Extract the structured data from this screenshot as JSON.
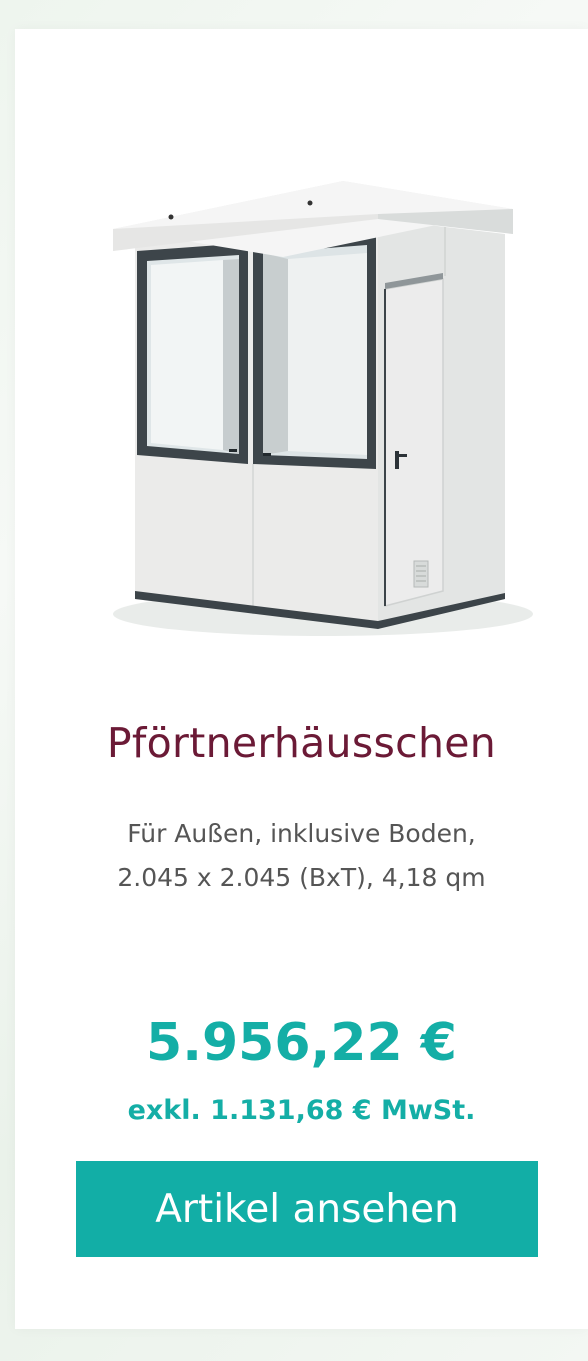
{
  "product": {
    "title": "Pförtnerhäusschen",
    "description_line1": "Für Außen, inklusive Boden,",
    "description_line2": "2.045 x 2.045 (BxT), 4,18 qm",
    "price": "5.956,22 €",
    "vat_note": "exkl. 1.131,68 € MwSt.",
    "button_label": "Artikel ansehen",
    "image_icon": "guard-booth-image"
  },
  "colors": {
    "title": "#6b1a36",
    "accent": "#12aea6",
    "text": "#555555",
    "background": "#eef5ee",
    "card": "#ffffff"
  }
}
